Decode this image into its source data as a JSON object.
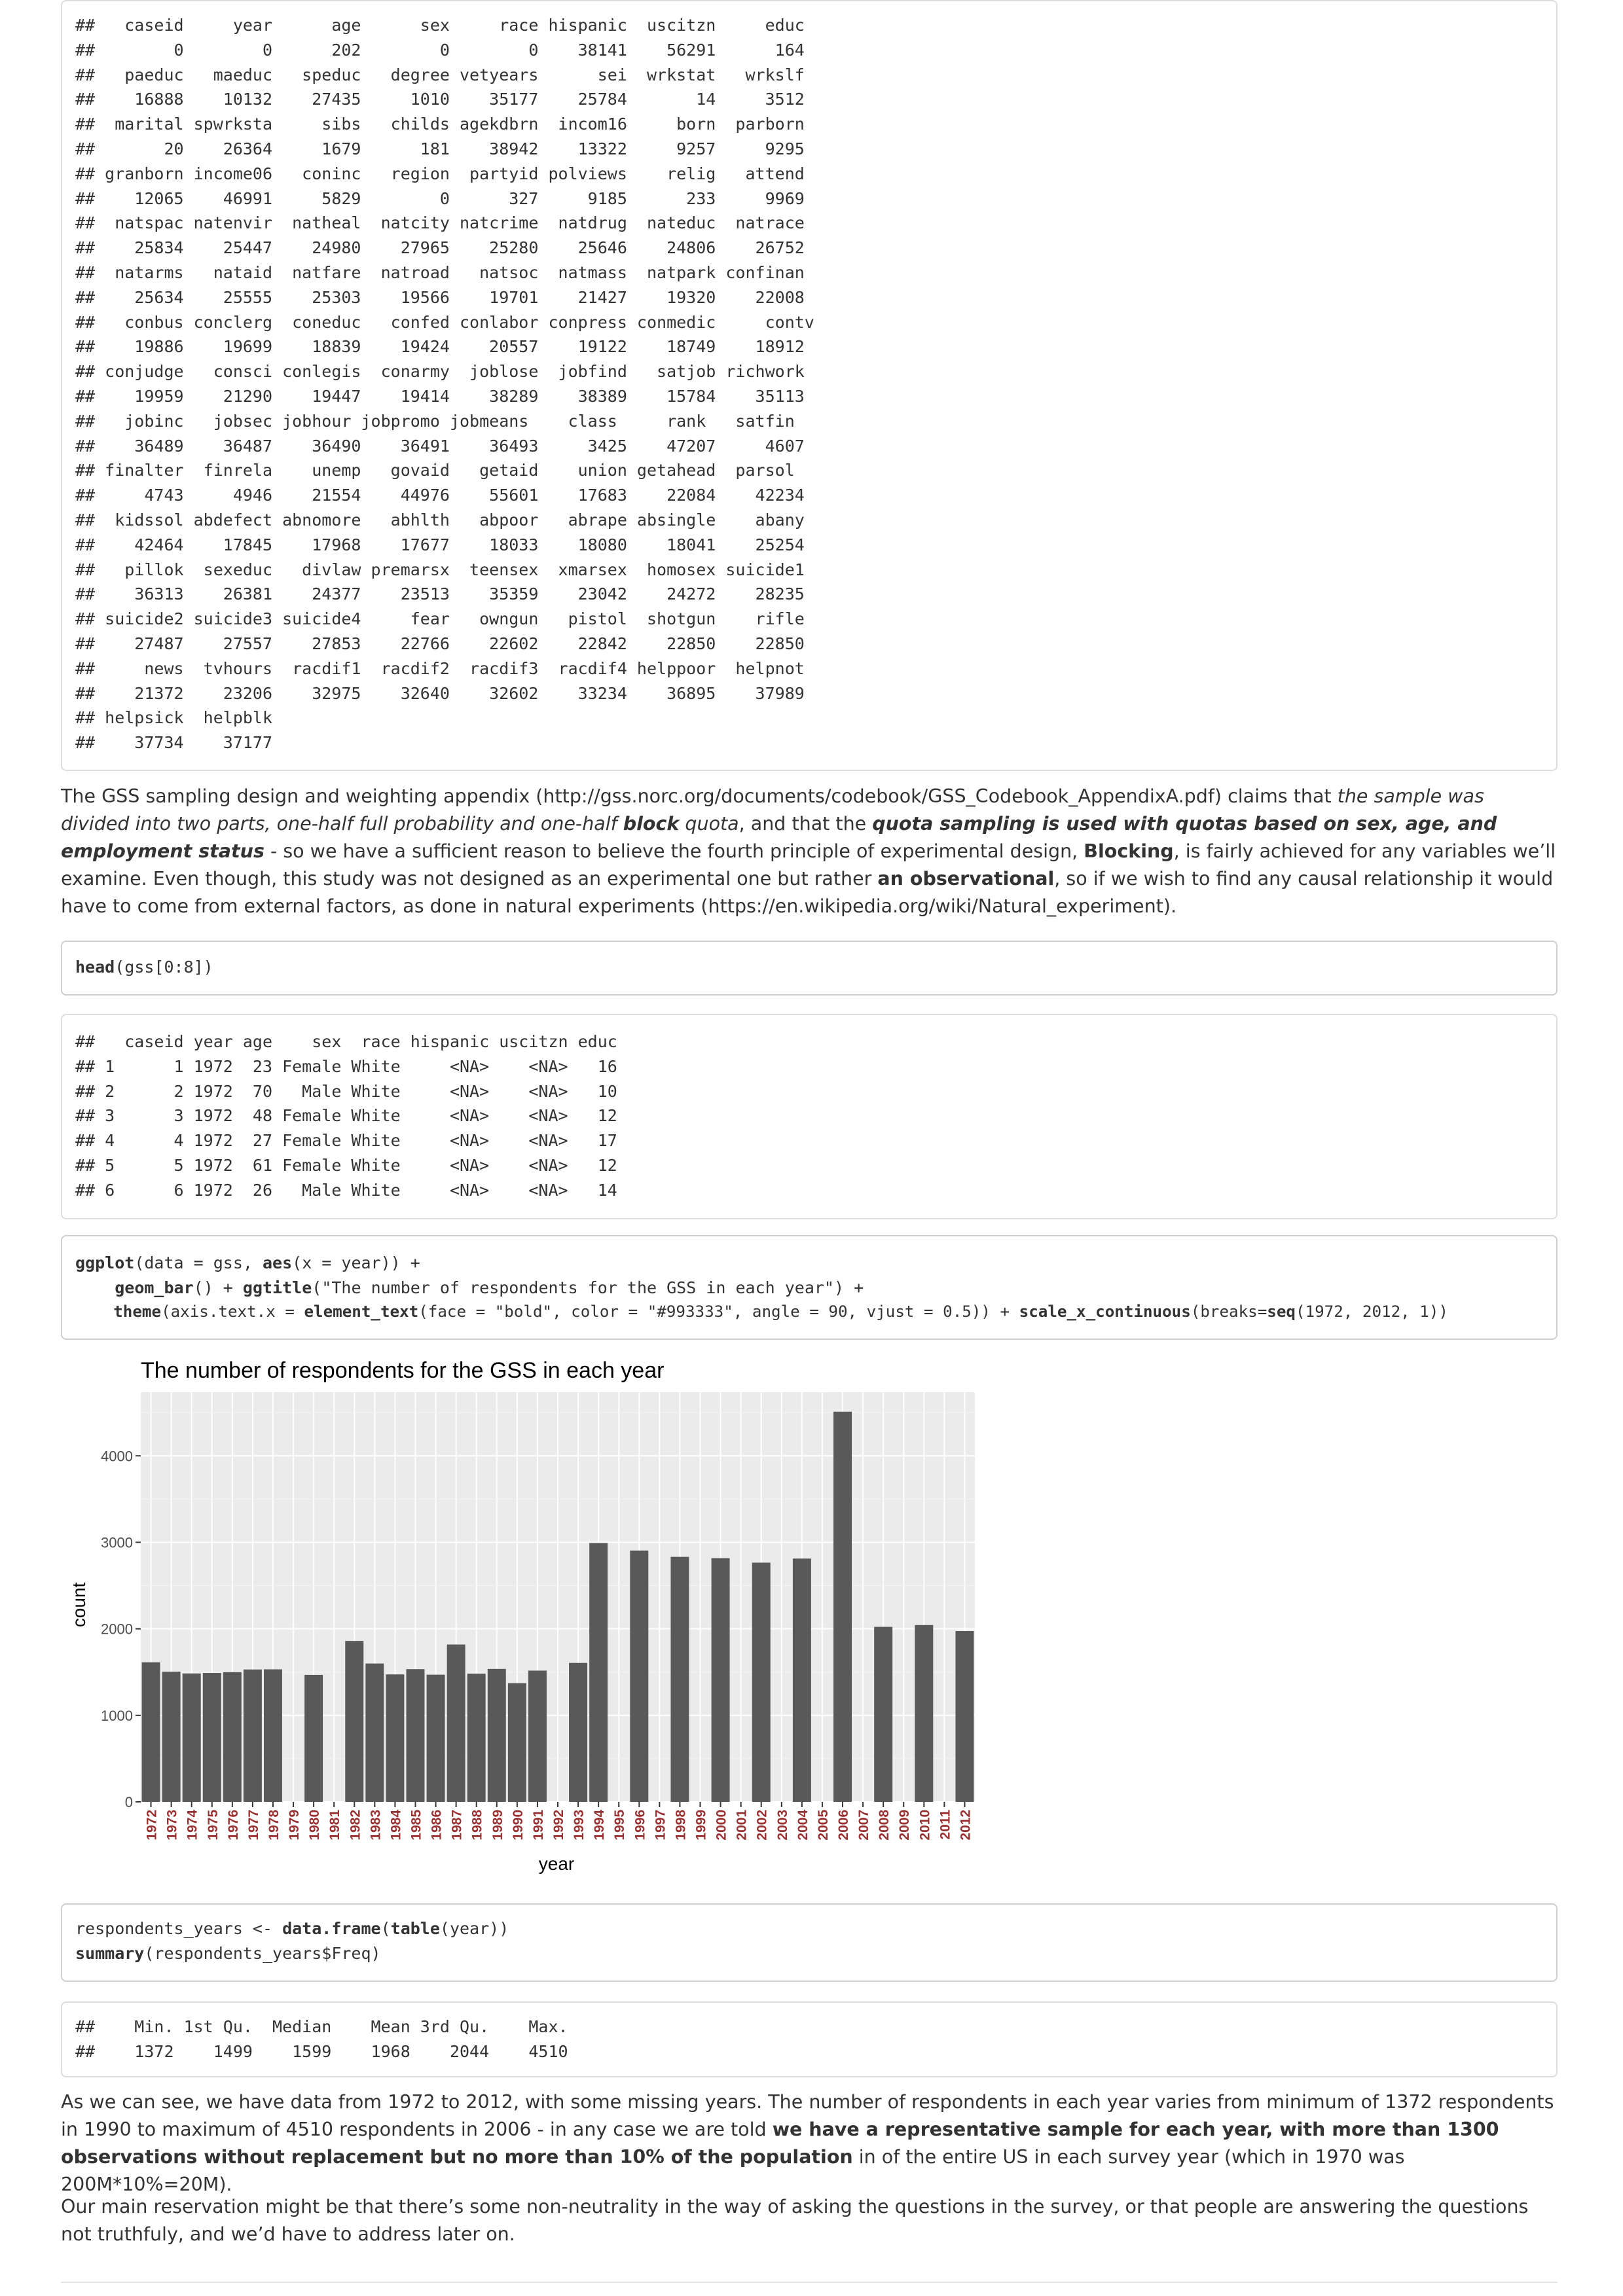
{
  "summary_output": {
    "lines": [
      "##   caseid     year      age      sex     race hispanic  uscitzn     educ",
      "##        0        0      202        0        0    38141    56291      164",
      "##   paeduc   maeduc   speduc   degree vetyears      sei  wrkstat   wrkslf",
      "##    16888    10132    27435     1010    35177    25784       14     3512",
      "##  marital spwrksta     sibs   childs agekdbrn  incom16     born  parborn",
      "##       20    26364     1679      181    38942    13322     9257     9295",
      "## granborn income06   coninc   region  partyid polviews    relig   attend",
      "##    12065    46991     5829        0      327     9185      233     9969",
      "##  natspac natenvir  natheal  natcity natcrime  natdrug  nateduc  natrace",
      "##    25834    25447    24980    27965    25280    25646    24806    26752",
      "##  natarms   nataid  natfare  natroad   natsoc  natmass  natpark confinan",
      "##    25634    25555    25303    19566    19701    21427    19320    22008",
      "##   conbus conclerg  coneduc   confed conlabor conpress conmedic     contv",
      "##    19886    19699    18839    19424    20557    19122    18749    18912",
      "## conjudge   consci conlegis  conarmy  joblose  jobfind   satjob richwork",
      "##    19959    21290    19447    19414    38289    38389    15784    35113",
      "##   jobinc   jobsec jobhour jobpromo jobmeans    class     rank   satfin",
      "##    36489    36487    36490    36491    36493     3425    47207     4607",
      "## finalter  finrela    unemp   govaid   getaid    union getahead  parsol",
      "##     4743     4946    21554    44976    55601    17683    22084    42234",
      "##  kidssol abdefect abnomore   abhlth   abpoor   abrape absingle    abany",
      "##    42464    17845    17968    17677    18033    18080    18041    25254",
      "##   pillok  sexeduc   divlaw premarsx  teensex  xmarsex  homosex suicide1",
      "##    36313    26381    24377    23513    35359    23042    24272    28235",
      "## suicide2 suicide3 suicide4     fear   owngun   pistol  shotgun    rifle",
      "##    27487    27557    27853    22766    22602    22842    22850    22850",
      "##     news  tvhours  racdif1  racdif2  racdif3  racdif4 helppoor  helpnot",
      "##    21372    23206    32975    32640    32602    33234    36895    37989",
      "## helpsick  helpblk",
      "##    37734    37177"
    ]
  },
  "para1": {
    "t1": "The GSS sampling design and weighting appendix (http://gss.norc.org/documents/codebook/GSS_Codebook_AppendixA.pdf) claims that ",
    "e1": "the sample was divided into two parts, one-half full probability and one-half ",
    "e1b": "block",
    "e2": " quota",
    "t2": ", and that the ",
    "s1": "quota sampling is used with quotas based on sex, age, and employment status",
    "t3": " - so we have a sufficient reason to believe the fourth principle of experimental design, ",
    "s2": "Blocking",
    "t4": ", is fairly achieved for any variables we’ll examine. Even though, this study was not designed as an experimental one but rather ",
    "s3": "an observational",
    "t5": ", so if we wish to find any causal relationship it would have to come from external factors, as done in natural experiments (https://en.wikipedia.org/wiki/Natural_experiment)."
  },
  "code_head": {
    "fn": "head",
    "rest": "(gss[0:8])"
  },
  "head_output": {
    "lines": [
      "##   caseid year age    sex  race hispanic uscitzn educ",
      "## 1      1 1972  23 Female White     <NA>    <NA>   16",
      "## 2      2 1972  70   Male White     <NA>    <NA>   10",
      "## 3      3 1972  48 Female White     <NA>    <NA>   12",
      "## 4      4 1972  27 Female White     <NA>    <NA>   17",
      "## 5      5 1972  61 Female White     <NA>    <NA>   12",
      "## 6      6 1972  26   Male White     <NA>    <NA>   14"
    ]
  },
  "code_ggplot": {
    "l1_fn": "ggplot",
    "l1_a": "(data = gss, ",
    "l1_fn2": "aes",
    "l1_b": "(x = year)) +",
    "l2_indent": "    ",
    "l2_fn": "geom_bar",
    "l2_a": "() + ",
    "l2_fn2": "ggtitle",
    "l2_b": "(\"The number of respondents for the GSS in each year\") +",
    "l3_indent": "    ",
    "l3_fn": "theme",
    "l3_a": "(axis.text.x = ",
    "l3_fn2": "element_text",
    "l3_b": "(face = \"bold\", color = \"#993333\", angle = 90, vjust = 0.5)) + ",
    "l3_fn3": "scale_x_continuous",
    "l3_c": "(breaks=",
    "l3_fn4": "seq",
    "l3_d": "(1972, 2012, 1))"
  },
  "chart_data": {
    "type": "bar",
    "title": "The number of respondents for the GSS in each year",
    "xlabel": "year",
    "ylabel": "count",
    "x": [
      1972,
      1973,
      1974,
      1975,
      1976,
      1977,
      1978,
      1980,
      1982,
      1983,
      1984,
      1985,
      1986,
      1987,
      1988,
      1989,
      1990,
      1991,
      1993,
      1994,
      1996,
      1998,
      2000,
      2002,
      2004,
      2006,
      2008,
      2010,
      2012
    ],
    "values": [
      1613,
      1504,
      1484,
      1490,
      1499,
      1530,
      1532,
      1468,
      1860,
      1599,
      1473,
      1534,
      1470,
      1819,
      1481,
      1537,
      1372,
      1517,
      1606,
      2992,
      2904,
      2832,
      2817,
      2765,
      2812,
      4510,
      2023,
      2044,
      1974
    ],
    "x_ticks": [
      1972,
      1973,
      1974,
      1975,
      1976,
      1977,
      1978,
      1979,
      1980,
      1981,
      1982,
      1983,
      1984,
      1985,
      1986,
      1987,
      1988,
      1989,
      1990,
      1991,
      1992,
      1993,
      1994,
      1995,
      1996,
      1997,
      1998,
      1999,
      2000,
      2001,
      2002,
      2003,
      2004,
      2005,
      2006,
      2007,
      2008,
      2009,
      2010,
      2011,
      2012
    ],
    "y_ticks": [
      0,
      1000,
      2000,
      3000,
      4000
    ],
    "xlim": [
      1971.5,
      2012.5
    ],
    "ylim": [
      0,
      4736
    ],
    "grid": true,
    "bar_color": "#595959",
    "panel_color": "#ebebeb",
    "tick_label_color": "#993333"
  },
  "code_summary": {
    "l1_a": "respondents_years <- ",
    "l1_fn": "data.frame",
    "l1_b": "(",
    "l1_fn2": "table",
    "l1_c": "(year))",
    "l2_fn": "summary",
    "l2_a": "(respondents_years$Freq)"
  },
  "summary_stats_output": {
    "lines": [
      "##    Min. 1st Qu.  Median    Mean 3rd Qu.    Max.",
      "##    1372    1499    1599    1968    2044    4510"
    ]
  },
  "para2": {
    "t1": "As we can see, we have data from 1972 to 2012, with some missing years. The number of respondents in each year varies from minimum of 1372 respondents in 1990 to maximum of 4510 respondents in 2006 - in any case we are told ",
    "s1": "we have a representative sample for each year, with more than 1300 observations without replacement but no more than 10% of the population",
    "t2": " in of the entire US in each survey year (which in 1970 was 200M*10%=20M)."
  },
  "para3": {
    "t1": "Our main reservation might be that there’s some non-neutrality in the way of asking the questions in the survey, or that people are answering the questions not truthfuly, and we’d have to address later on."
  }
}
